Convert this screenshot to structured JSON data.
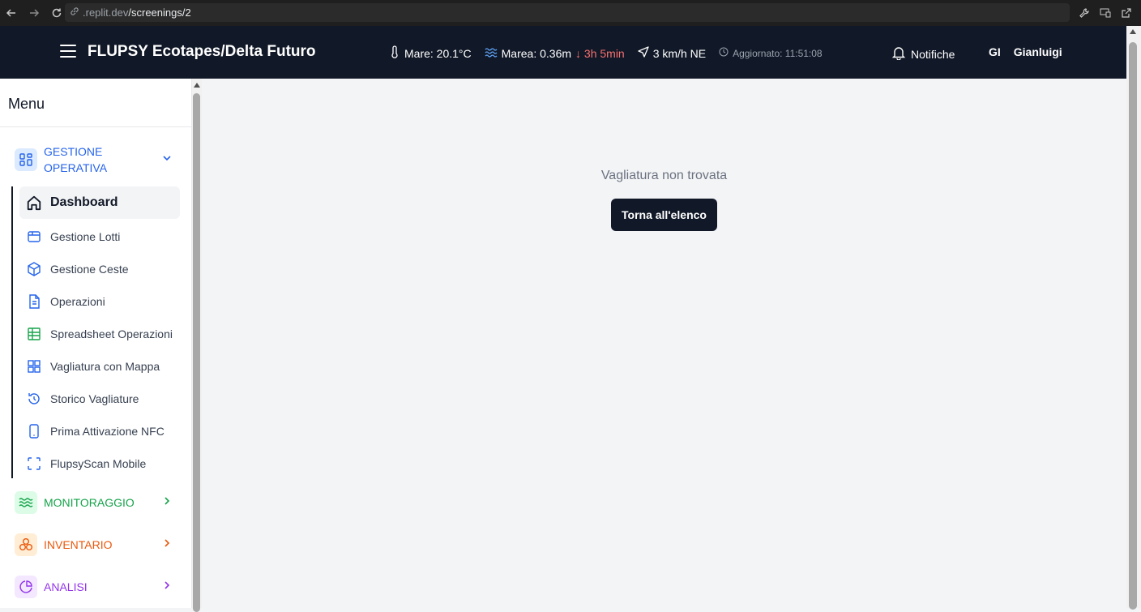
{
  "browser": {
    "url_domain": ".replit.dev",
    "url_path": "/screenings/2"
  },
  "header": {
    "app_title": "FLUPSY Ecotapes/Delta Futuro",
    "sea_temp": "Mare: 20.1°C",
    "tide": "Marea: 0.36m",
    "tide_trend": "↓ 3h 5min",
    "wind": "3 km/h NE",
    "updated": "Aggiornato: 11:51:08",
    "notifications_label": "Notifiche",
    "user_initials": "GI",
    "user_name": "Gianluigi"
  },
  "sidebar": {
    "title": "Menu",
    "sections": [
      {
        "label": "GESTIONE OPERATIVA",
        "color": "#2563eb",
        "bg": "#dbeafe",
        "icon": "layout-grid-icon",
        "expanded": true
      },
      {
        "label": "MONITORAGGIO",
        "color": "#16a34a",
        "bg": "#dcfce7",
        "icon": "waves-icon",
        "expanded": false
      },
      {
        "label": "INVENTARIO",
        "color": "#ea580c",
        "bg": "#ffedd5",
        "icon": "boxes-icon",
        "expanded": false
      },
      {
        "label": "ANALISI",
        "color": "#9333ea",
        "bg": "#f3e8ff",
        "icon": "pie-chart-icon",
        "expanded": false
      }
    ],
    "items": [
      {
        "label": "Dashboard",
        "icon": "home-icon",
        "active": true
      },
      {
        "label": "Gestione Lotti",
        "icon": "package-icon"
      },
      {
        "label": "Gestione Ceste",
        "icon": "box-icon"
      },
      {
        "label": "Operazioni",
        "icon": "file-text-icon"
      },
      {
        "label": "Spreadsheet Operazioni",
        "icon": "table-icon"
      },
      {
        "label": "Vagliatura con Mappa",
        "icon": "grid-icon"
      },
      {
        "label": "Storico Vagliature",
        "icon": "history-icon"
      },
      {
        "label": "Prima Attivazione NFC",
        "icon": "smartphone-icon"
      },
      {
        "label": "FlupsyScan Mobile",
        "icon": "scan-icon"
      }
    ]
  },
  "main": {
    "message": "Vagliatura non trovata",
    "back_button": "Torna all'elenco"
  }
}
